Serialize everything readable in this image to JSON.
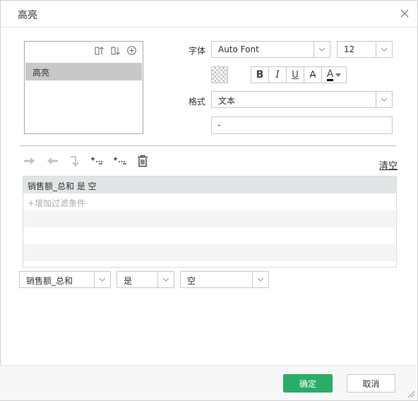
{
  "dialog": {
    "title": "高亮",
    "close_icon": "close-icon"
  },
  "highlight_list": {
    "tools": [
      "sort-ascending-icon",
      "sort-descending-icon",
      "add-circle-icon"
    ],
    "items": [
      {
        "label": "高亮",
        "selected": true
      }
    ]
  },
  "font": {
    "label": "字体",
    "family": "Auto Font",
    "size": "12",
    "background_icon": "transparent-color-icon",
    "style_buttons": {
      "bold": "B",
      "italic": "I",
      "underline": "U",
      "strikethrough": "A",
      "font_color": "A"
    }
  },
  "format": {
    "label": "格式",
    "type": "文本",
    "pattern_value": "-"
  },
  "filter_toolbar": {
    "buttons": [
      "arrow-right-icon",
      "arrow-left-icon",
      "branch-icon",
      "insert-condition-icon",
      "remove-condition-icon",
      "trash-icon"
    ],
    "clear_label": "清空"
  },
  "filter_rows": [
    {
      "text": "销售额_总和 是 空",
      "selected": true
    },
    {
      "text": "+增加过滤条件",
      "placeholder": true
    }
  ],
  "condition_editor": {
    "field": "销售额_总和",
    "operator": "是",
    "value": "空"
  },
  "footer": {
    "ok_label": "确定",
    "cancel_label": "取消"
  },
  "colors": {
    "accent_green": "#2aae67",
    "selected_row": "#c8c8c8",
    "filter_selected": "#e1e5e6",
    "stripe": "#f5f5f5"
  }
}
